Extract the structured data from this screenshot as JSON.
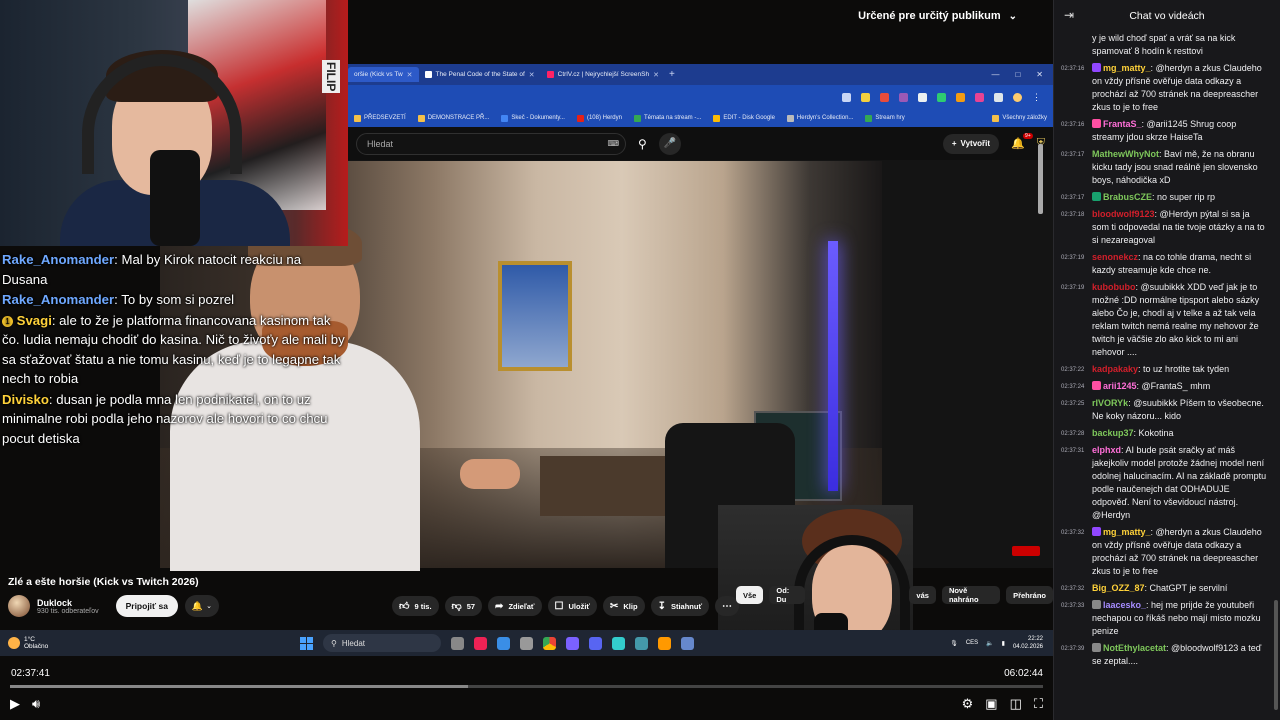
{
  "video": {
    "audience_label": "Určené pre určitý publikum",
    "title": "Zlé a ešte horšie (Kick vs Twitch 2026)",
    "channel": {
      "name": "Duklock",
      "subscribers": "930 tis. odberateľov",
      "subscribe_label": "Pripojiť sa"
    },
    "actions": {
      "likes": "9 tis.",
      "dislikes": "57",
      "share": "Zdieľať",
      "save": "Uložiť",
      "clip": "Klip",
      "download": "Stiahnuť"
    },
    "chips": [
      "Vše",
      "Od: Du",
      "vás",
      "Nově nahráno",
      "Přehráno"
    ],
    "time_current": "02:37:41",
    "time_total": "06:02:44",
    "progress": 0.433
  },
  "capture": {
    "tabs": [
      {
        "label": "oršie (Kick vs Tw",
        "active": true
      },
      {
        "label": "The Penal Code of the State of",
        "active": false
      },
      {
        "label": "CtrlV.cz | Nejrychlejší ScreenSh",
        "active": false
      }
    ],
    "bookmarks": [
      "PŘEDSEVZETÍ",
      "DEMONSTRACE PŘ...",
      "Skeč - Dokumenty...",
      "(108) Herdyn",
      "Témata na stream -...",
      "EDIT - Disk Google",
      "Herdyn's Collection...",
      "Stream hry"
    ],
    "bookmarks_all": "Všechny záložky",
    "search_placeholder": "Hledat",
    "create_label": "Vytvořit",
    "bell_badge": "9+"
  },
  "taskbar": {
    "weather_temp": "1°C",
    "weather_desc": "Oblačno",
    "search_label": "Hledat",
    "lang": "CES",
    "time": "22:22",
    "date": "04.02.2026"
  },
  "overlay_chat": [
    {
      "name": "Rake_Anomander",
      "text": ": Mal by Kirok natocit reakciu na Dusana",
      "color": "n1",
      "badge": false
    },
    {
      "name": "Rake_Anomander",
      "text": ": To by som si pozrel",
      "color": "n1",
      "badge": false
    },
    {
      "name": "Svagi",
      "text": ": ale to že je platforma financovana kasinom tak čo. ludia nemaju chodiť do kasina. Nič to živoťy ale mali by sa sťažovať štatu a nie tomu kasinu, keď je to legapne tak nech to robia",
      "color": "n2",
      "badge": true
    },
    {
      "name": "Divisko",
      "text": ": dusan je podla mna len podnikatel, on to uz minimalne robi podla jeho nazorov ale hovori to co chcu pocut detiska",
      "color": "n2",
      "badge": false
    }
  ],
  "chat": {
    "title": "Chat vo videách",
    "messages": [
      {
        "ts": "",
        "name": "",
        "color": "#efeff1",
        "text": "y je wild choď spať a vráť sa na kick spamovať 8 hodín k resttovi",
        "badge": ""
      },
      {
        "ts": "02:37:16",
        "name": "mg_matty_",
        "color": "#ffd23a",
        "text": ": @herdyn a zkus Claudeho on vždy přísně ověřuje data odkazy a prochází až 700 stránek na deepreascher zkus to je to free",
        "badge": "#9147ff"
      },
      {
        "ts": "02:37:16",
        "name": "FrantaS_",
        "color": "#ff6fd8",
        "text": ": @arii1245 Shrug coop streamy jdou skrze HaiseTa",
        "badge": "#ff4fa3"
      },
      {
        "ts": "02:37:17",
        "name": "MathewWhyNot",
        "color": "#7ec75b",
        "text": ": Baví mě, že na obranu kicku tady jsou snad reálně jen slovensko boys, náhodička xD",
        "badge": ""
      },
      {
        "ts": "02:37:17",
        "name": "BrabusCZE",
        "color": "#7ec75b",
        "text": ": no super rip rp",
        "badge": "#18a16e"
      },
      {
        "ts": "02:37:18",
        "name": "bloodwolf9123",
        "color": "#d21f2b",
        "text": ": @Herdyn pýtal si sa ja som ti odpovedal na tie tvoje otázky a na to si nezareagoval",
        "badge": ""
      },
      {
        "ts": "02:37:19",
        "name": "senonekcz",
        "color": "#d21f2b",
        "text": ": na co tohle drama, necht si kazdy streamuje kde chce ne.",
        "badge": ""
      },
      {
        "ts": "02:37:19",
        "name": "kubobubo",
        "color": "#d21f2b",
        "text": ": @suubikkk XDD veď jak je to možné :DD normálne tipsport alebo sázky alebo Čo je, chodí aj v telke a až tak vela reklam twitch nemá realne my nehovor že twitch je väčšie zlo ako kick to mi ani nehovor ....",
        "badge": ""
      },
      {
        "ts": "02:37:22",
        "name": "kadpakaky",
        "color": "#d21f2b",
        "text": ": to uz hrotite tak tyden",
        "badge": ""
      },
      {
        "ts": "02:37:24",
        "name": "arii1245",
        "color": "#ff6fd8",
        "text": ": @FrantaS_ mhm",
        "badge": "#ff4fa3"
      },
      {
        "ts": "02:37:25",
        "name": "rIVORYk",
        "color": "#7ec75b",
        "text": ": @suubikkk Píšem to všeobecne. Ne koky názoru... kido",
        "badge": ""
      },
      {
        "ts": "02:37:28",
        "name": "backup37",
        "color": "#7ec75b",
        "text": ": Kokotina",
        "badge": ""
      },
      {
        "ts": "02:37:31",
        "name": "elphxd",
        "color": "#ff6fd8",
        "text": ": AI bude psát sračky ať máš jakejkoliv model protože žádnej model není odolnej halucinacím. AI na základě promptu podle naučenejch dat ODHADUJE odpověď. Není to vševidoucí nástroj. @Herdyn",
        "badge": ""
      },
      {
        "ts": "02:37:32",
        "name": "mg_matty_",
        "color": "#ffd23a",
        "text": ": @herdyn a zkus Claudeho on vždy přísně ověřuje data odkazy a prochází až 700 stránek na deepreascher zkus to je to free",
        "badge": "#9147ff"
      },
      {
        "ts": "02:37:32",
        "name": "Big_OZZ_87",
        "color": "#ffd23a",
        "text": ": ChatGPT je servilní",
        "badge": ""
      },
      {
        "ts": "02:37:33",
        "name": "laacesko_",
        "color": "#a58cff",
        "text": ": hej me prijde že youtubeři nechapou co říkáš nebo mají misto mozku penize",
        "badge": "#888"
      },
      {
        "ts": "02:37:39",
        "name": "NotEthylacetat",
        "color": "#7ec75b",
        "text": ": @bloodwolf9123 a teď se zeptal....",
        "badge": "#888"
      }
    ]
  }
}
